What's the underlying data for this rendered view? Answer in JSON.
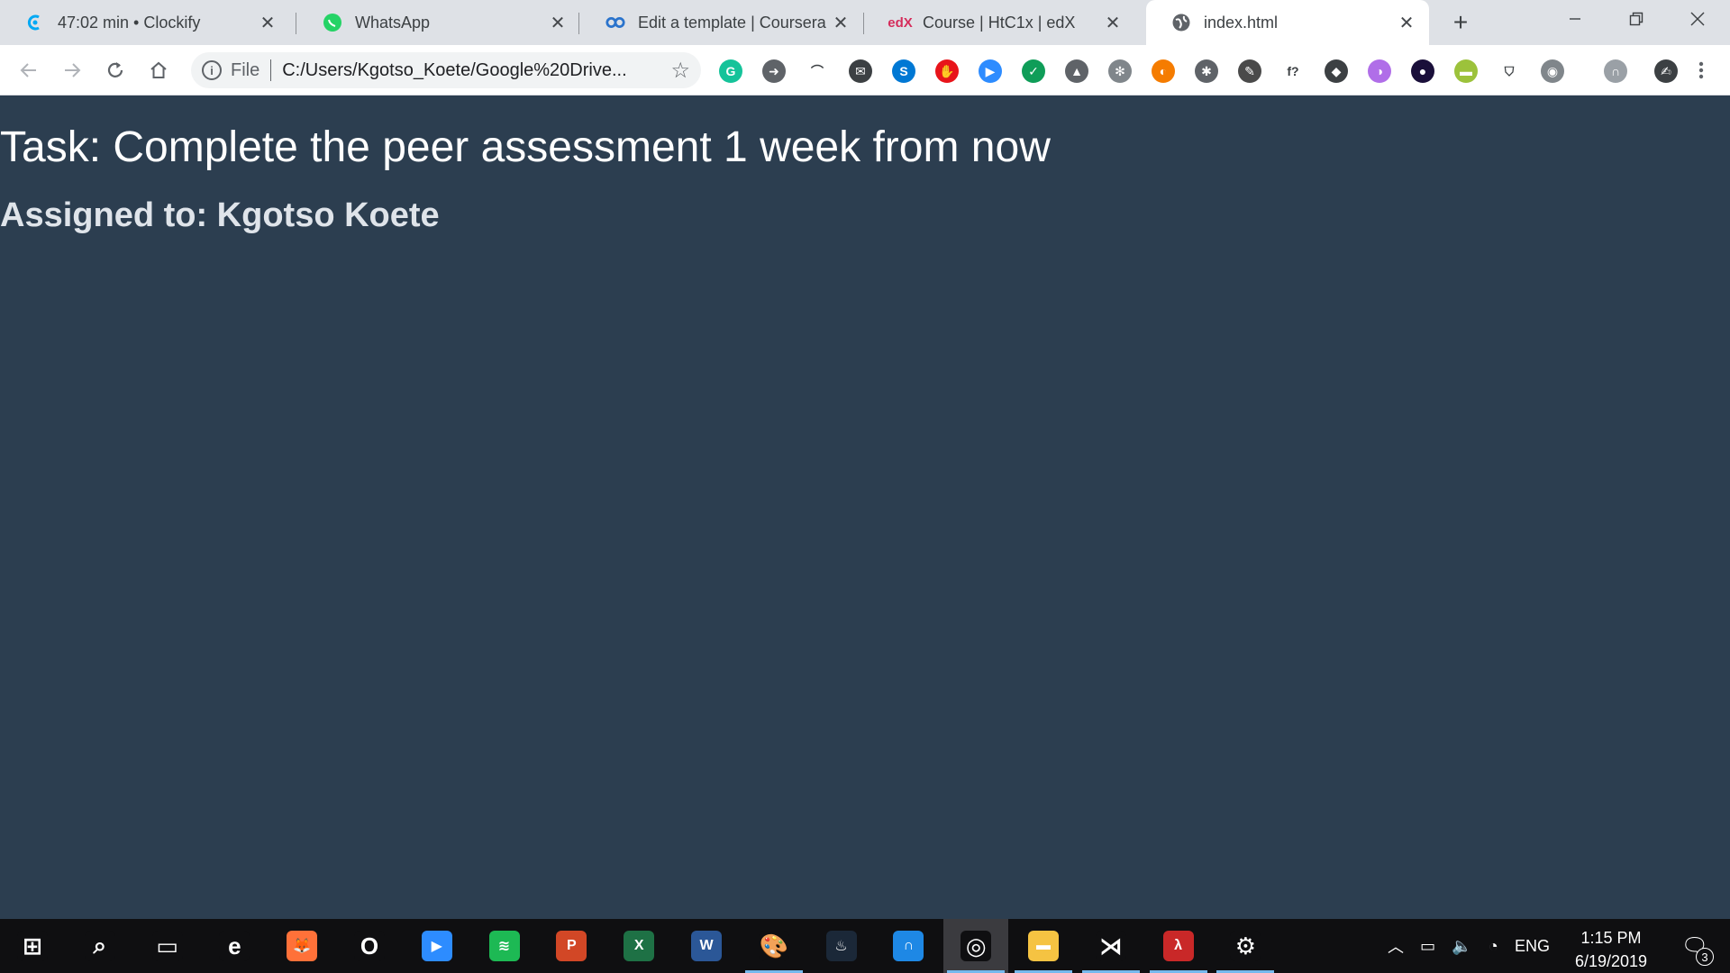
{
  "browser": {
    "tabs": [
      {
        "title": "47:02 min • Clockify",
        "favicon": "clockify-icon"
      },
      {
        "title": "WhatsApp",
        "favicon": "whatsapp-icon"
      },
      {
        "title": "Edit a template | Coursera",
        "favicon": "coursera-icon"
      },
      {
        "title": "Course | HtC1x | edX",
        "favicon": "edx-icon"
      },
      {
        "title": "index.html",
        "favicon": "globe-icon",
        "active": true
      }
    ],
    "omnibox": {
      "scheme": "File",
      "url": "C:/Users/Kgotso_Koete/Google%20Drive..."
    },
    "extensions": [
      {
        "name": "grammarly-icon",
        "color": "#15c39a",
        "glyph": "G"
      },
      {
        "name": "arrow-ext-icon",
        "color": "#5f6368",
        "glyph": "➜"
      },
      {
        "name": "rainbow-ext-icon",
        "color": "#ffffff",
        "glyph": "⌒"
      },
      {
        "name": "mail-ext-icon",
        "color": "#3c4043",
        "glyph": "✉"
      },
      {
        "name": "skype-icon",
        "color": "#0078d4",
        "glyph": "S"
      },
      {
        "name": "adblock-icon",
        "color": "#e8141a",
        "glyph": "✋"
      },
      {
        "name": "zoom-ext-icon",
        "color": "#2d8cff",
        "glyph": "▶"
      },
      {
        "name": "shield-ext-icon",
        "color": "#0f9d58",
        "glyph": "✓"
      },
      {
        "name": "drive-ext-icon",
        "color": "#5f6368",
        "glyph": "▲"
      },
      {
        "name": "gear-ext-icon",
        "color": "#80868b",
        "glyph": "✻"
      },
      {
        "name": "orange-ext-icon",
        "color": "#f57c00",
        "glyph": "◐"
      },
      {
        "name": "bug-ext-icon",
        "color": "#5f6368",
        "glyph": "✱"
      },
      {
        "name": "eyedropper-ext-icon",
        "color": "#4a4a4a",
        "glyph": "✎"
      },
      {
        "name": "font-ext-icon",
        "color": "#ffffff",
        "glyph": "f?"
      },
      {
        "name": "layers-ext-icon",
        "color": "#3c4043",
        "glyph": "◆"
      },
      {
        "name": "purple-ext-icon",
        "color": "#b06ee8",
        "glyph": "◑"
      },
      {
        "name": "colorful-ext-icon",
        "color": "#1a0f3a",
        "glyph": "●"
      },
      {
        "name": "plant-ext-icon",
        "color": "#9cc23b",
        "glyph": "▬"
      },
      {
        "name": "pocket-icon",
        "color": "#ffffff",
        "glyph": "⛉"
      },
      {
        "name": "camera-ext-icon",
        "color": "#80868b",
        "glyph": "◉"
      },
      {
        "name": "arc-ext-icon",
        "color": "#9aa0a6",
        "glyph": "∩"
      },
      {
        "name": "signature-ext-icon",
        "color": "#3c4043",
        "glyph": "✍"
      }
    ]
  },
  "page": {
    "task": "Task: Complete the peer assessment 1 week from now",
    "assigned": "Assigned to: Kgotso Koete"
  },
  "taskbar": {
    "apps": [
      {
        "name": "windows-start-icon",
        "color": "#0f0f11",
        "glyph": "⊞"
      },
      {
        "name": "search-icon",
        "color": "#0f0f11",
        "glyph": "⌕"
      },
      {
        "name": "task-view-icon",
        "color": "#0f0f11",
        "glyph": "▭"
      },
      {
        "name": "edge-icon",
        "color": "#0f0f11",
        "glyph": "e"
      },
      {
        "name": "firefox-icon",
        "color": "#ff7139",
        "glyph": "🦊"
      },
      {
        "name": "opera-icon",
        "color": "#0f0f11",
        "glyph": "O"
      },
      {
        "name": "zoom-icon",
        "color": "#2d8cff",
        "glyph": "▶"
      },
      {
        "name": "spotify-icon",
        "color": "#1db954",
        "glyph": "≋"
      },
      {
        "name": "powerpoint-icon",
        "color": "#d24726",
        "glyph": "P"
      },
      {
        "name": "excel-icon",
        "color": "#1e7145",
        "glyph": "X"
      },
      {
        "name": "word-icon",
        "color": "#2b5797",
        "glyph": "W"
      },
      {
        "name": "paint-icon",
        "color": "#0f0f11",
        "glyph": "🎨"
      },
      {
        "name": "steam-icon",
        "color": "#1b2838",
        "glyph": "♨"
      },
      {
        "name": "arc-app-icon",
        "color": "#1e88e5",
        "glyph": "∩"
      },
      {
        "name": "chrome-icon",
        "color": "#0f0f11",
        "glyph": "◎",
        "active": true
      },
      {
        "name": "file-explorer-icon",
        "color": "#f5c342",
        "glyph": "▬"
      },
      {
        "name": "vscode-icon",
        "color": "#0f0f11",
        "glyph": "⋊"
      },
      {
        "name": "racket-icon",
        "color": "#c92828",
        "glyph": "λ"
      },
      {
        "name": "settings-icon",
        "color": "#0f0f11",
        "glyph": "⚙"
      }
    ],
    "tray": {
      "language": "ENG",
      "time": "1:15 PM",
      "date": "6/19/2019",
      "notification_count": "3"
    }
  }
}
